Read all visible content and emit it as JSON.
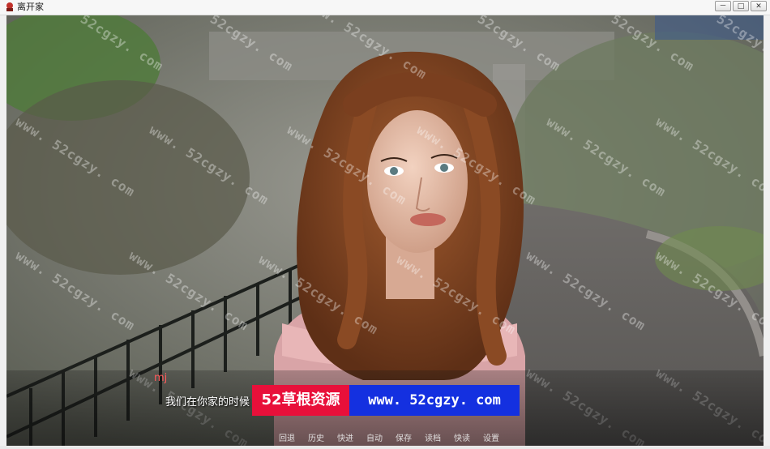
{
  "window": {
    "title": "离开家",
    "buttons": [
      "－",
      "□",
      "✕"
    ]
  },
  "watermark": "www. 52cgzy. com",
  "dialog": {
    "speaker": "mj",
    "text": "我们在你家的时候"
  },
  "banner": {
    "left": "52草根资源",
    "right": "www. 52cgzy. com"
  },
  "menu": [
    "回退",
    "历史",
    "快进",
    "自动",
    "保存",
    "读档",
    "快读",
    "设置"
  ]
}
